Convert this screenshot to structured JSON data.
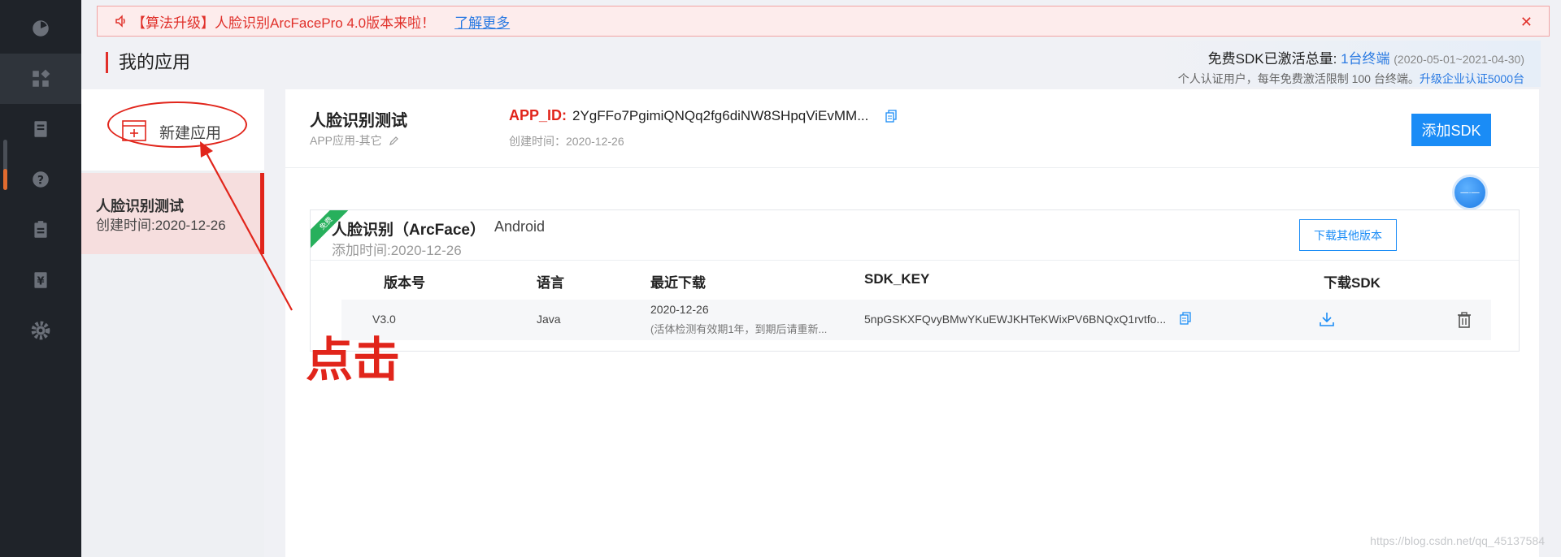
{
  "notice": {
    "text": "【算法升级】人脸识别ArcFacePro 4.0版本来啦！",
    "link": "了解更多",
    "close": "✕"
  },
  "page": {
    "title": "我的应用"
  },
  "quota": {
    "label": "免费SDK已激活总量:",
    "count": "1台终端",
    "range": "(2020-05-01~2021-04-30)",
    "note": "个人认证用户，每年免费激活限制 100 台终端。",
    "upgrade": "升级企业认证5000台"
  },
  "sidebar_apps": {
    "new_app": "新建应用",
    "items": [
      {
        "name": "人脸识别测试",
        "created": "创建时间:2020-12-26"
      }
    ]
  },
  "app_detail": {
    "name": "人脸识别测试",
    "type": "APP应用-其它",
    "app_id_label": "APP_ID:",
    "app_id": "2YgFFo7PgimiQNQq2fg6diNW8SHpqViEvMM...",
    "created": "创建时间：2020-12-26",
    "add_sdk": "添加SDK"
  },
  "sdk_card": {
    "ribbon": "免费",
    "title": "人脸识别（ArcFace）",
    "platform": "Android",
    "added": "添加时间:2020-12-26",
    "download_other": "下载其他版本",
    "columns": [
      "版本号",
      "语言",
      "最近下载",
      "SDK_KEY",
      "下载SDK"
    ],
    "rows": [
      {
        "version": "V3.0",
        "language": "Java",
        "last_download": "2020-12-26",
        "download_note": "(活体检测有效期1年，到期后请重新...",
        "sdk_key": "5npGSKXFQvyBMwYKuEWJKHTeKWixPV6BNQxQ1rvtfo..."
      }
    ]
  },
  "annotation": {
    "text": "点击"
  },
  "watermark": "https://blog.csdn.net/qq_45137584",
  "colors": {
    "accent_red": "#e1251b",
    "primary_blue": "#1a8cf6",
    "nav_bg": "#1f2329"
  },
  "nav_icons": [
    "dashboard-icon",
    "apps-icon",
    "book-icon",
    "help-icon",
    "clipboard-icon",
    "yen-icon",
    "settings-icon"
  ]
}
